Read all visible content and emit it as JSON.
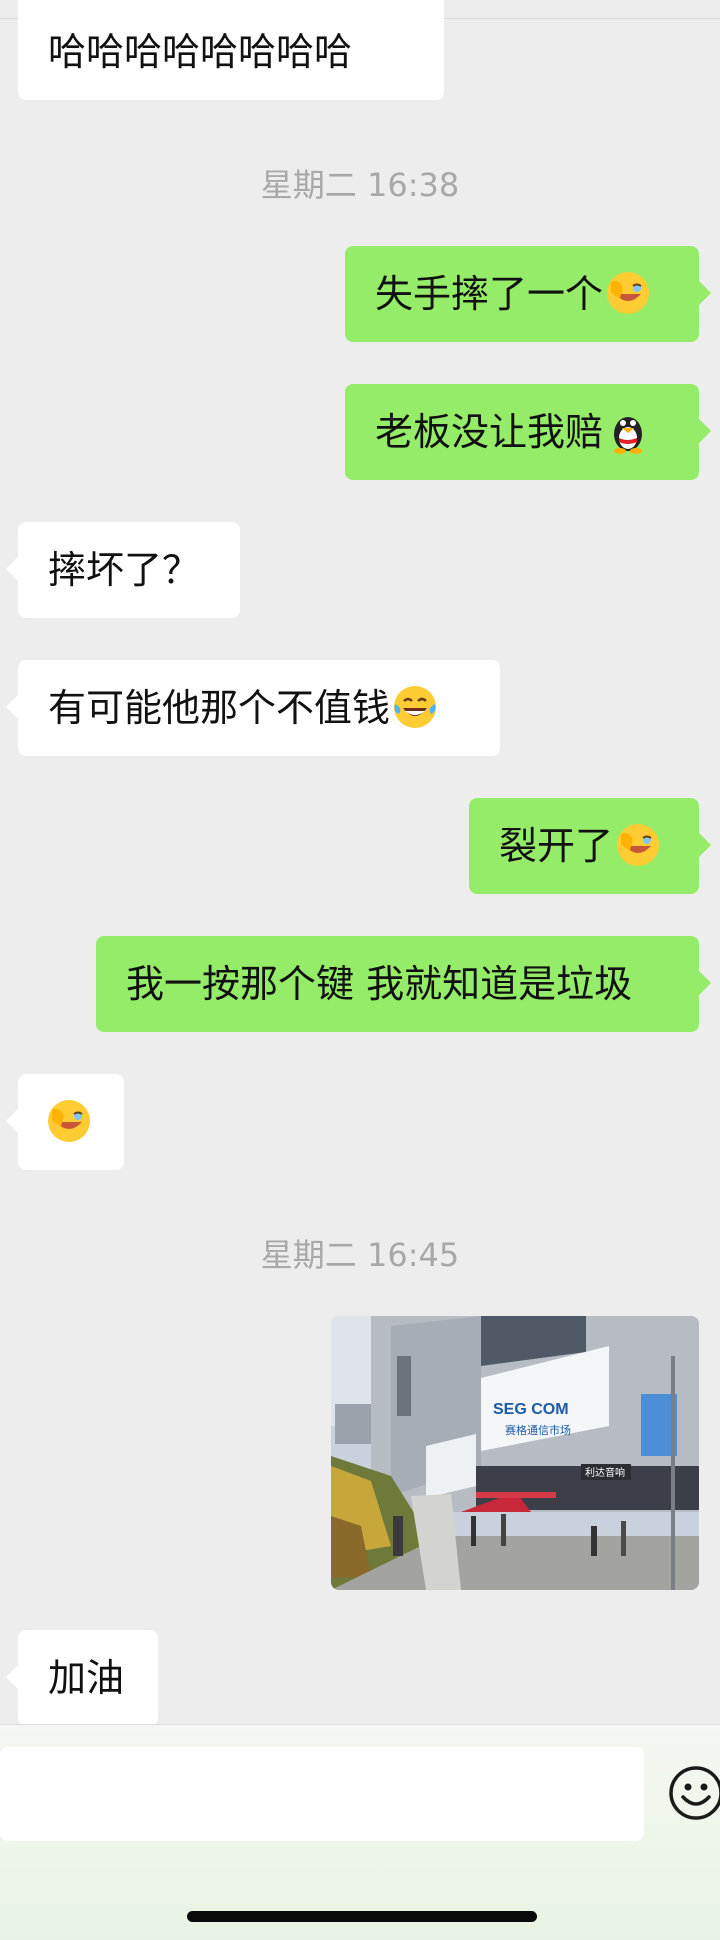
{
  "chat": {
    "msg1": "哈哈哈哈哈哈哈哈",
    "time1": "星期二 16:38",
    "msg2": "失手摔了一个",
    "msg3": "老板没让我赔",
    "msg4": "摔坏了？",
    "msg5": "有可能他那个不值钱",
    "msg6": "裂开了",
    "msg7": "我一按那个键 我就知道是垃圾",
    "time2": "星期二 16:45",
    "msg8_photo_caption": "SEG COM 赛格通信市场",
    "msg9": "加油"
  },
  "photo": {
    "sign_main": "SEG COM",
    "sign_sub": "赛格通信市场",
    "sign_shop": "利达音响"
  },
  "icons": {
    "emoji_facepalm": "face-palm-icon",
    "emoji_qq": "qq-penguin-icon",
    "emoji_laugh_cry": "laugh-cry-icon",
    "emoji_button": "smiley-icon"
  },
  "colors": {
    "background": "#ededed",
    "sent_bubble": "#95ec69",
    "received_bubble": "#ffffff"
  }
}
